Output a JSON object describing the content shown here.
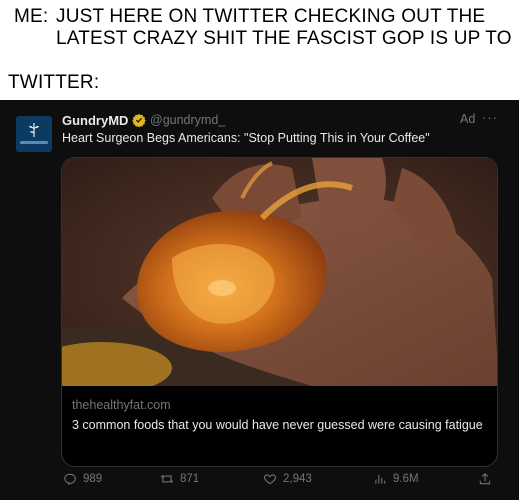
{
  "meme": {
    "me_label": "ME:",
    "line1": "JUST HERE ON TWITTER CHECKING OUT THE",
    "line2": "LATEST CRAZY SHIT THE FASCIST GOP IS UP TO",
    "twitter_label": "TWITTER:"
  },
  "tweet": {
    "display_name": "GundryMD",
    "handle": "@gundrymd_",
    "ad_label": "Ad",
    "more": "···",
    "headline": "Heart Surgeon Begs Americans: \"Stop Putting This in Your Coffee\"",
    "card": {
      "domain": "thehealthyfat.com",
      "description": "3 common foods that you would have never guessed were causing fatigue"
    },
    "stats": {
      "replies": "989",
      "retweets": "871",
      "likes": "2,943",
      "views": "9.6M"
    },
    "icons": {
      "avatar": "gundrymd-logo-icon",
      "verified": "verified-badge-icon",
      "reply": "reply-icon",
      "retweet": "retweet-icon",
      "like": "heart-icon",
      "views": "analytics-icon",
      "share": "share-icon"
    },
    "colors": {
      "background": "#0e0e0f",
      "text": "#e7e9ea",
      "muted": "#71767b",
      "verified": "#e2b719"
    }
  }
}
